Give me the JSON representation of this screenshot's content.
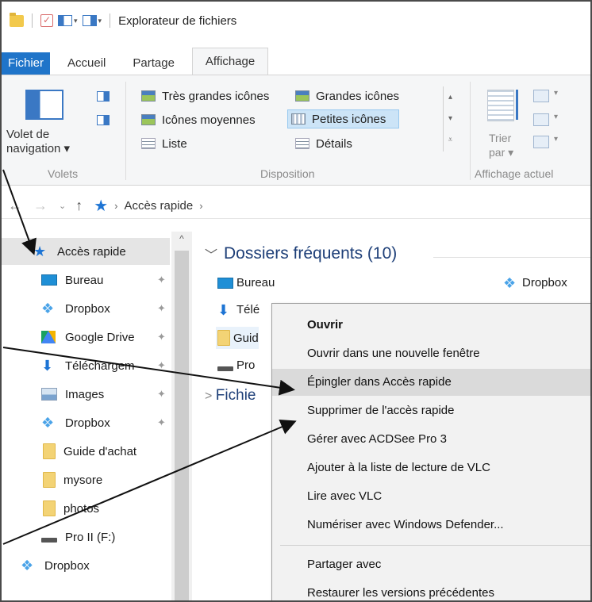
{
  "window": {
    "title": "Explorateur de fichiers"
  },
  "ribbon": {
    "tabs": [
      {
        "label": "Fichier"
      },
      {
        "label": "Accueil"
      },
      {
        "label": "Partage"
      },
      {
        "label": "Affichage"
      }
    ],
    "volets": {
      "nav_label_line1": "Volet de",
      "nav_label_line2": "navigation ▾",
      "group_label": "Volets"
    },
    "disposition": {
      "items": [
        "Très grandes icônes",
        "Grandes icônes",
        "Icônes moyennes",
        "Petites icônes",
        "Liste",
        "Détails"
      ],
      "group_label": "Disposition"
    },
    "affichage": {
      "sort_line1": "Trier",
      "sort_line2": "par ▾",
      "group_label": "Affichage actuel"
    }
  },
  "address": {
    "crumb": "Accès rapide",
    "chevron1": "›",
    "chevron2": "›"
  },
  "nav_pane": {
    "items": [
      {
        "label": "Accès rapide",
        "icon": "star-icon"
      },
      {
        "label": "Bureau",
        "icon": "desktop-icon"
      },
      {
        "label": "Dropbox",
        "icon": "dropbox-icon"
      },
      {
        "label": "Google Drive",
        "icon": "google-drive-icon"
      },
      {
        "label": "Téléchargem",
        "icon": "download-icon"
      },
      {
        "label": "Images",
        "icon": "images-icon"
      },
      {
        "label": "Dropbox",
        "icon": "dropbox-icon"
      },
      {
        "label": "Guide d'achat",
        "icon": "folder-icon"
      },
      {
        "label": "mysore",
        "icon": "folder-icon"
      },
      {
        "label": "photos",
        "icon": "folder-icon"
      },
      {
        "label": "Pro II (F:)",
        "icon": "drive-icon"
      },
      {
        "label": "Dropbox",
        "icon": "dropbox-icon"
      }
    ],
    "pin_glyph": "📌"
  },
  "main": {
    "frequent_header": "Dossiers fréquents (10)",
    "recent_header": "Fichie",
    "items": {
      "bureau": "Bureau",
      "dropbox": "Dropbox",
      "tele": "Télé",
      "guid": "Guid",
      "pro": "Pro"
    }
  },
  "context_menu": {
    "items": [
      "Ouvrir",
      "Ouvrir dans une nouvelle fenêtre",
      "Épingler dans Accès rapide",
      "Supprimer de l'accès rapide",
      "Gérer avec ACDSee Pro 3",
      "Ajouter à la liste de lecture de VLC",
      "Lire avec VLC",
      "Numériser avec Windows Defender...",
      "Partager avec",
      "Restaurer les versions précédentes"
    ]
  },
  "colors": {
    "accent": "#1f74c9",
    "highlight": "#cce4f7",
    "menu_hover": "#dadada"
  }
}
